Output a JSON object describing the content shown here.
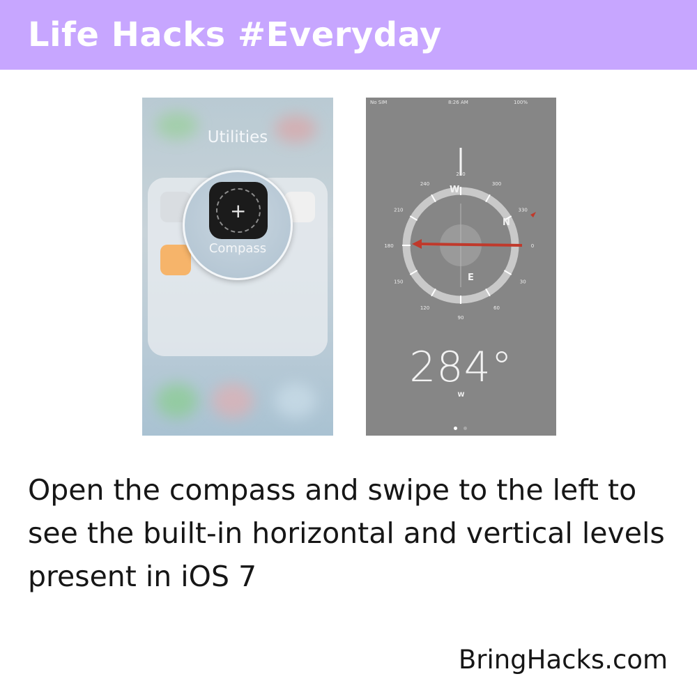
{
  "header": {
    "title": "Life Hacks #Everyday"
  },
  "left_screen": {
    "folder_title": "Utilities",
    "app_label": "Compass"
  },
  "right_screen": {
    "status": {
      "carrier": "No SIM",
      "time": "8:26 AM",
      "battery": "100%"
    },
    "dial_numbers": [
      "270",
      "300",
      "330",
      "0",
      "30",
      "60",
      "90",
      "120",
      "150",
      "180",
      "210",
      "240"
    ],
    "cardinals": {
      "north": "N",
      "east": "E",
      "west": "W"
    },
    "heading": "284°",
    "heading_direction": "W"
  },
  "caption": "Open the compass and swipe to the left to see the built-in horizontal and vertical levels present in iOS 7",
  "footer": {
    "site": "BringHacks.com"
  },
  "colors": {
    "banner": "#c7a6ff",
    "needle": "#c0392b"
  }
}
